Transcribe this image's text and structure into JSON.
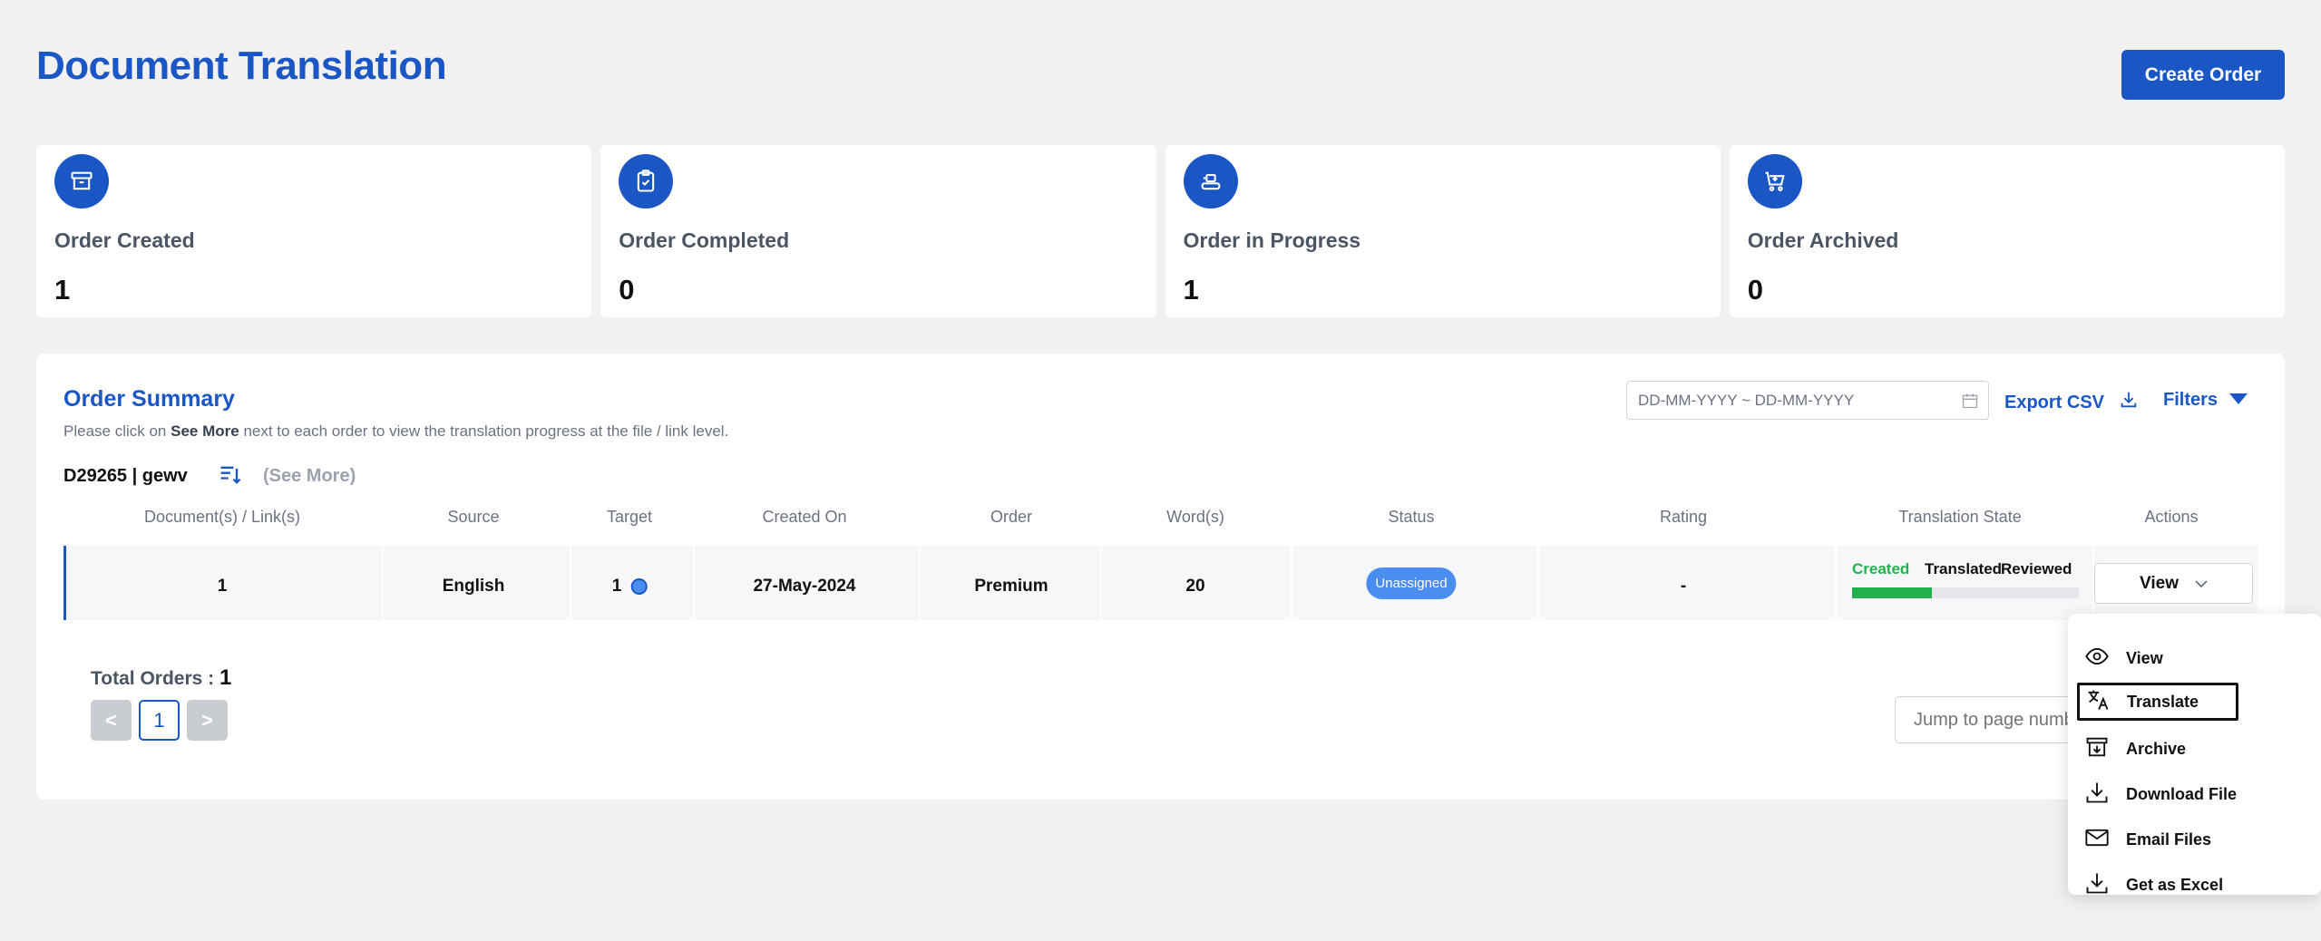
{
  "header": {
    "title": "Document Translation",
    "create_order_label": "Create Order"
  },
  "stats": [
    {
      "label": "Order Created",
      "value": "1",
      "icon": "archive-box-icon"
    },
    {
      "label": "Order Completed",
      "value": "0",
      "icon": "clipboard-check-icon"
    },
    {
      "label": "Order in Progress",
      "value": "1",
      "icon": "conveyor-icon"
    },
    {
      "label": "Order Archived",
      "value": "0",
      "icon": "cart-icon"
    }
  ],
  "summary": {
    "title": "Order Summary",
    "hint_prefix": "Please click on ",
    "hint_bold": "See More",
    "hint_suffix": " next to each order to view the translation progress at the file / link level.",
    "date_placeholder": "DD-MM-YYYY ~ DD-MM-YYYY",
    "export_label": "Export CSV",
    "filters_label": "Filters",
    "order_id": "D29265 | gewv",
    "see_more": "(See More)",
    "columns": [
      "Document(s) / Link(s)",
      "Source",
      "Target",
      "Created On",
      "Order",
      "Word(s)",
      "Status",
      "Rating",
      "Translation State",
      "Actions"
    ],
    "row": {
      "documents": "1",
      "source": "English",
      "target": "1",
      "created_on": "27-May-2024",
      "order": "Premium",
      "words": "20",
      "status": "Unassigned",
      "rating": "-",
      "state_created": "Created",
      "state_translated": "Translated",
      "state_reviewed": "Reviewed",
      "progress": 0.35,
      "action_label": "View"
    },
    "total_label": "Total Orders : ",
    "total_value": "1",
    "pager": {
      "prev": "<",
      "current": "1",
      "next": ">"
    },
    "jump_placeholder": "Jump to page number"
  },
  "dropdown": [
    {
      "label": "View",
      "icon": "eye-icon"
    },
    {
      "label": "Translate",
      "icon": "translate-icon"
    },
    {
      "label": "Archive",
      "icon": "archive-icon"
    },
    {
      "label": "Download File",
      "icon": "download-icon"
    },
    {
      "label": "Email Files",
      "icon": "mail-icon"
    },
    {
      "label": "Get as Excel",
      "icon": "excel-download-icon"
    }
  ],
  "colors": {
    "primary": "#1a56c4",
    "success": "#22b14c",
    "badge": "#4a8df0"
  }
}
